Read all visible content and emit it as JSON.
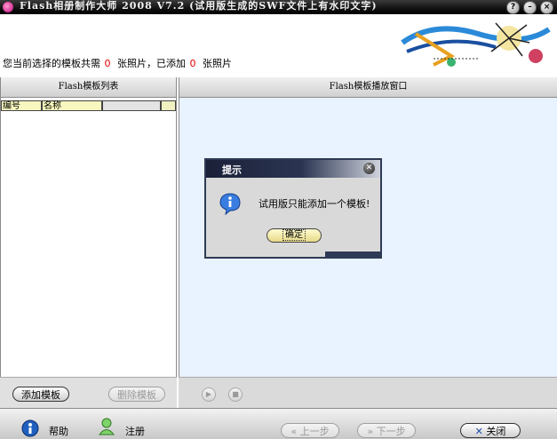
{
  "window": {
    "title": "Flash相册制作大师 2008 V7.2 (试用版生成的SWF文件上有水印文字)",
    "controls": [
      "?",
      "–",
      "×"
    ]
  },
  "info": {
    "prefix": "您当前选择的模板共需",
    "required_count": "0",
    "middle": "张照片，已添加",
    "added_count": "0",
    "suffix": "张照片"
  },
  "left_panel": {
    "title": "Flash模板列表",
    "columns": [
      "编号",
      "名称"
    ]
  },
  "right_panel": {
    "title": "Flash模板播放窗口"
  },
  "buttons": {
    "add_template": "添加模板",
    "delete_template": "删除模板"
  },
  "player": {
    "play_icon": "play-icon",
    "stop_icon": "stop-icon"
  },
  "statusbar": {
    "help": "帮助",
    "register": "注册",
    "prev": "上一步",
    "next": "下一步",
    "close": "关闭"
  },
  "dialog": {
    "title": "提示",
    "message": "试用版只能添加一个模板!",
    "ok": "确定"
  },
  "colors": {
    "accent_red": "#e00000",
    "dialog_frame": "#2e3a55",
    "column_header": "#f7f7bf",
    "player_bg": "#e9f2ff"
  }
}
